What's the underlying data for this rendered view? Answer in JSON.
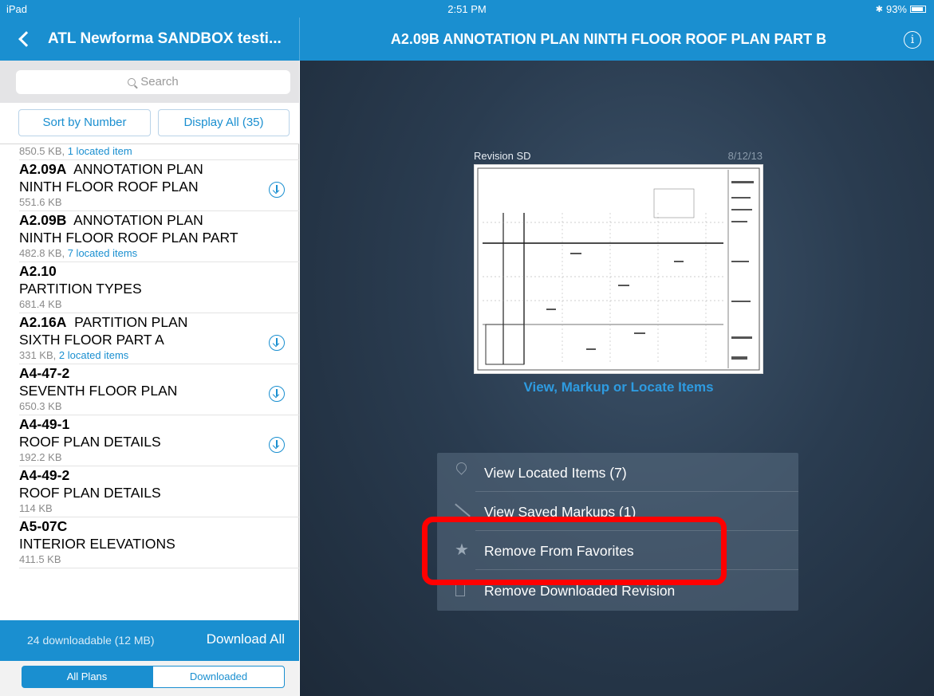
{
  "status_bar": {
    "device": "iPad",
    "time": "2:51 PM",
    "battery": "93%"
  },
  "nav": {
    "left_title": "ATL Newforma SANDBOX testi...",
    "right_title": "A2.09B ANNOTATION PLAN NINTH FLOOR ROOF PLAN PART B"
  },
  "search": {
    "placeholder": "Search"
  },
  "sort": {
    "sort_label": "Sort by Number",
    "display_label": "Display All (35)"
  },
  "list": {
    "top_meta": "850.5 KB, ",
    "top_link": "1 located item",
    "items": [
      {
        "number": "A2.09A",
        "title_inline": "ANNOTATION PLAN",
        "title_line2": "NINTH FLOOR ROOF PLAN",
        "size": "551.6 KB",
        "link": "",
        "download": true
      },
      {
        "number": "A2.09B",
        "title_inline": "ANNOTATION PLAN",
        "title_line2": "NINTH FLOOR ROOF PLAN PART",
        "size": "482.8 KB, ",
        "link": "7 located items",
        "download": false
      },
      {
        "number": "A2.10",
        "title_inline": "",
        "title_line2": "PARTITION TYPES",
        "size": "681.4 KB",
        "link": "",
        "download": false
      },
      {
        "number": "A2.16A",
        "title_inline": "PARTITION PLAN",
        "title_line2": "SIXTH FLOOR PART A",
        "size": "331 KB, ",
        "link": "2 located items",
        "download": true
      },
      {
        "number": "A4-47-2",
        "title_inline": "",
        "title_line2": "SEVENTH FLOOR PLAN",
        "size": "650.3 KB",
        "link": "",
        "download": true
      },
      {
        "number": "A4-49-1",
        "title_inline": "",
        "title_line2": "ROOF PLAN DETAILS",
        "size": "192.2 KB",
        "link": "",
        "download": true
      },
      {
        "number": "A4-49-2",
        "title_inline": "",
        "title_line2": "ROOF PLAN DETAILS",
        "size": "114 KB",
        "link": "",
        "download": false
      },
      {
        "number": "A5-07C",
        "title_inline": "",
        "title_line2": "INTERIOR ELEVATIONS",
        "size": "411.5 KB",
        "link": "",
        "download": false
      }
    ]
  },
  "download_bar": {
    "info": "24 downloadable (12 MB)",
    "action": "Download All"
  },
  "segments": {
    "all": "All Plans",
    "downloaded": "Downloaded"
  },
  "detail": {
    "revision": "Revision SD",
    "date": "8/12/13",
    "markup_link": "View, Markup or Locate Items",
    "menu": [
      {
        "label": "View Located Items (7)",
        "icon": "location-pin-icon"
      },
      {
        "label": "View Saved Markups (1)",
        "icon": "pencil-icon"
      },
      {
        "label": "Remove From Favorites",
        "icon": "star-icon"
      },
      {
        "label": "Remove Downloaded Revision",
        "icon": "trash-icon"
      }
    ]
  },
  "colors": {
    "accent": "#1a8fd0",
    "highlight": "#ff0000"
  }
}
